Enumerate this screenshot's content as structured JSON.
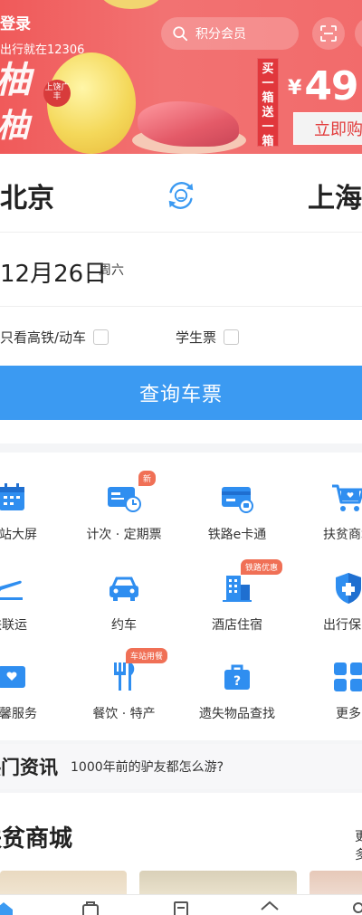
{
  "banner": {
    "login_title": "登录",
    "login_subtitle": "出行就在12306",
    "search_placeholder": "积分会员",
    "promo_tag": "买一箱送一箱",
    "price": "49",
    "price_currency": "¥",
    "buy_button": "立即购",
    "decor_char_1": "柚",
    "decor_char_2": "柚",
    "seal_text": "上饶广丰"
  },
  "booking": {
    "from_city": "北京",
    "to_city": "上海",
    "date": "12月26日",
    "weekday": "周六",
    "option_highspeed": "只看高铁/动车",
    "option_student": "学生票",
    "query_button": "查询车票"
  },
  "services": [
    {
      "label": "车站大屏",
      "icon": "station-screen-icon"
    },
    {
      "label": "计次 · 定期票",
      "icon": "pass-ticket-icon",
      "badge": "新"
    },
    {
      "label": "铁路e卡通",
      "icon": "rail-card-icon"
    },
    {
      "label": "扶贫商城",
      "icon": "shopping-cart-icon"
    },
    {
      "label": "铁联运",
      "icon": "airplane-train-icon"
    },
    {
      "label": "约车",
      "icon": "car-icon"
    },
    {
      "label": "酒店住宿",
      "icon": "hotel-icon",
      "badge": "铁路优惠"
    },
    {
      "label": "出行保险",
      "icon": "shield-icon"
    },
    {
      "label": "温馨服务",
      "icon": "heart-service-icon"
    },
    {
      "label": "餐饮 · 特产",
      "icon": "dining-icon",
      "badge": "车站用餐"
    },
    {
      "label": "遗失物品查找",
      "icon": "lost-found-icon"
    },
    {
      "label": "更多",
      "icon": "more-grid-icon"
    }
  ],
  "news": {
    "title": "热门资讯",
    "headline": "1000年前的驴友都怎么游?"
  },
  "mall": {
    "title": "扶贫商城",
    "more": "更多"
  },
  "colors": {
    "primary": "#3b9af2",
    "banner_red": "#f05a5a",
    "badge_orange": "#f07056"
  }
}
